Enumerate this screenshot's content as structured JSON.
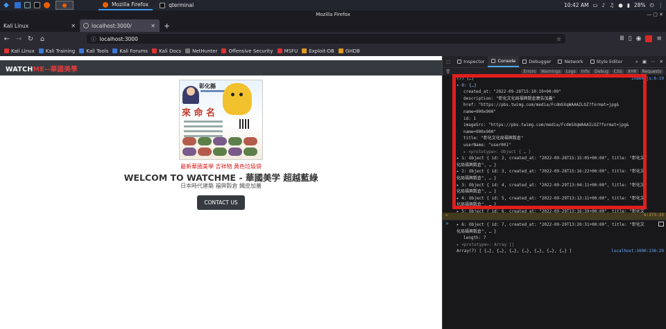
{
  "panel": {
    "tasks": [
      {
        "label": "Mozilla Firefox",
        "icon": "firefox-icon"
      },
      {
        "label": "qterminal",
        "icon": "terminal-icon"
      }
    ],
    "clock": "10:42 AM",
    "battery": "28%"
  },
  "window": {
    "title": "Mozilla Firefox"
  },
  "tabs": [
    {
      "label": "Kali Linux",
      "selected": false
    },
    {
      "label": "localhost:3000/",
      "selected": true
    }
  ],
  "url": "localhost:3000",
  "bookmarks": [
    {
      "label": "Kali Linux",
      "color": "#d33"
    },
    {
      "label": "Kali Training",
      "color": "#3b79d8"
    },
    {
      "label": "Kali Tools",
      "color": "#3b79d8"
    },
    {
      "label": "Kali Forums",
      "color": "#3b79d8"
    },
    {
      "label": "Kali Docs",
      "color": "#d33"
    },
    {
      "label": "NetHunter",
      "color": "#777"
    },
    {
      "label": "Offensive Security",
      "color": "#d33"
    },
    {
      "label": "MSFU",
      "color": "#d33"
    },
    {
      "label": "Exploit-DB",
      "color": "#e39a1e"
    },
    {
      "label": "GHDB",
      "color": "#e39a1e"
    }
  ],
  "site": {
    "brand_white": "WATCH",
    "brand_red": "ME--華國美學",
    "poster_title": "彰化縣",
    "poster_big": "來 命 名",
    "caption": "最新華國美學 吉祥物 黃色垃圾袋",
    "welcome": "WELCOM TO WATCHME - 華國美学 超越藍綠",
    "subtext": "日本時代建築 福興穀倉 鐵皮加蓋",
    "contact_button": "CONTACT US"
  },
  "devtools": {
    "tabs": [
      "Inspector",
      "Console",
      "Debugger",
      "Network",
      "Style Editor"
    ],
    "selected_tab": "Console",
    "filter_buttons": [
      "Errors",
      "Warnings",
      "Logs",
      "Info",
      "Debug",
      "CSS",
      "XHR",
      "Requests"
    ],
    "console_lines": [
      {
        "text": "(7) […]",
        "src": "index.js:6:10",
        "cls": "",
        "indent": ""
      },
      {
        "text": "▾ 0: {…}",
        "src": "",
        "cls": "k",
        "indent": ""
      },
      {
        "text": "created_at: \"2022-09-28T15:10:19+00:00\"",
        "src": "",
        "cls": "",
        "indent": "i1"
      },
      {
        "text": "description: \"彰化文化局福興穀倉廣告加蓋\"",
        "src": "",
        "cls": "",
        "indent": "i1"
      },
      {
        "text": "href: \"https://pbs.twimg.com/media/FcdmSXqWAAAILOZ?format=jpg&",
        "src": "",
        "cls": "",
        "indent": "i1"
      },
      {
        "text": "name=900x900\"",
        "src": "",
        "cls": "",
        "indent": "i1"
      },
      {
        "text": "id: 1",
        "src": "",
        "cls": "",
        "indent": "i1"
      },
      {
        "text": "imageSrc: \"https://pbs.twimg.com/media/FcdmSXqWAAAILOZ?format=jpg&",
        "src": "",
        "cls": "",
        "indent": "i1"
      },
      {
        "text": "name=900x900\"",
        "src": "",
        "cls": "",
        "indent": "i1"
      },
      {
        "text": "title: \"彰化文化局福興穀倉\"",
        "src": "",
        "cls": "",
        "indent": "i1"
      },
      {
        "text": "userName: \"user001\"",
        "src": "",
        "cls": "",
        "indent": "i1"
      },
      {
        "text": "▸ <prototype>: Object { … }",
        "src": "",
        "cls": "g",
        "indent": "i1"
      },
      {
        "text": "▸ 1: Object { id: 2, created_at: \"2022-09-28T15:15:05+00:00\", title: \"彰化文",
        "src": "",
        "cls": "",
        "indent": ""
      },
      {
        "text": "化局福興穀倉\", … }",
        "src": "",
        "cls": "",
        "indent": ""
      },
      {
        "text": "▸ 2: Object { id: 3, created_at: \"2022-09-28T15:16:22+00:00\", title: \"彰化文",
        "src": "",
        "cls": "",
        "indent": ""
      },
      {
        "text": "化局福興穀倉\", … }",
        "src": "",
        "cls": "",
        "indent": ""
      },
      {
        "text": "▸ 3: Object { id: 4, created_at: \"2022-09-29T13:04:11+00:00\", title: \"彰化文",
        "src": "",
        "cls": "",
        "indent": ""
      },
      {
        "text": "化局福興穀倉\", … }",
        "src": "",
        "cls": "",
        "indent": ""
      },
      {
        "text": "▸ 4: Object { id: 5, created_at: \"2022-09-29T13:13:11+00:00\", title: \"彰化文",
        "src": "",
        "cls": "",
        "indent": ""
      },
      {
        "text": "化局福興穀倉\", … }",
        "src": "",
        "cls": "",
        "indent": ""
      },
      {
        "text": "▸ 5: Object { id: 6, created_at: \"2022-09-29T13:16:39+00:00\", title: \"彰化文",
        "src": "",
        "cls": "",
        "indent": ""
      },
      {
        "text": "化局福興穀倉\", … }",
        "src": "",
        "cls": "",
        "indent": ""
      },
      {
        "text": "▸ 6: Object { id: 7, created_at: \"2022-09-29T13:20:31+00:00\", title: \"彰化文",
        "src": "",
        "cls": "",
        "indent": ""
      },
      {
        "text": "化局福興穀倉\", … }",
        "src": "",
        "cls": "",
        "indent": ""
      },
      {
        "text": "length: 7",
        "src": "",
        "cls": "",
        "indent": "i1"
      },
      {
        "text": "▸ <prototype>: Array []",
        "src": "",
        "cls": "g",
        "indent": ""
      },
      {
        "text": "Array(7) [ {…}, {…}, {…}, {…}, {…}, {…}, {…} ]",
        "src": "localhost:3000:236:29",
        "cls": "",
        "indent": ""
      }
    ],
    "warning_src": "e:273:33",
    "prompt": "»"
  }
}
